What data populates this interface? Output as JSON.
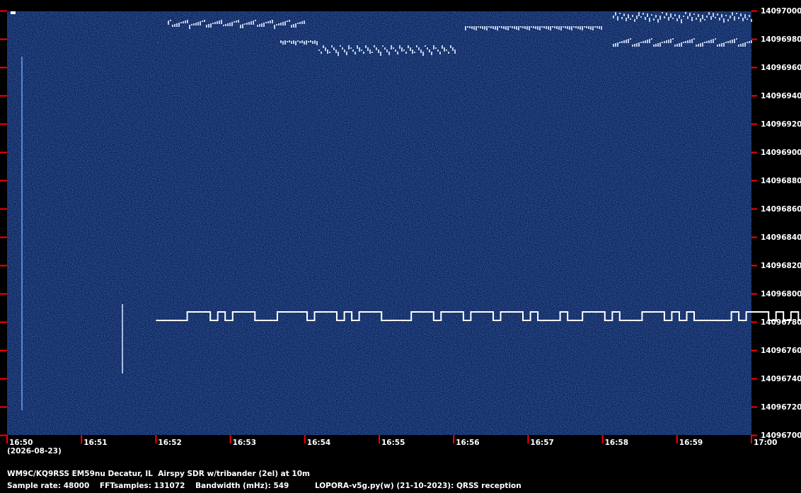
{
  "footer": {
    "station": "WM9C/KQ9RSS EM59nu Decatur, IL  Airspy SDR w/tribander (2el) at 10m",
    "sample_rate_label": "Sample rate: 48000",
    "fft_label": "FFTsamples: 131072",
    "bandwidth_label": "Bandwidth (mHz): 549",
    "software_label": "LOPORA-v5g.py(w) (21-10-2023): QRSS reception"
  },
  "date": "(2026-08-23)",
  "colors": {
    "background": "#0b2158",
    "tick": "#ff0000",
    "trace": "#ffffff",
    "frame": "#000000"
  },
  "chart_data": {
    "type": "heatmap",
    "title": "",
    "xlabel": "",
    "ylabel": "",
    "x_ticks": [
      "16:50",
      "16:51",
      "16:52",
      "16:53",
      "16:54",
      "16:55",
      "16:56",
      "16:57",
      "16:58",
      "16:59",
      "17:00"
    ],
    "y_ticks": [
      14097000,
      14096980,
      14096960,
      14096940,
      14096920,
      14096900,
      14096880,
      14096860,
      14096840,
      14096820,
      14096800,
      14096780,
      14096760,
      14096740,
      14096720,
      14096700
    ],
    "xlim": [
      "16:50",
      "17:00"
    ],
    "ylim": [
      14096700,
      14097000
    ],
    "grid": false,
    "fsk_trace": {
      "name": "",
      "start": "16:52",
      "end": "16:59.8",
      "low_freq": 14096781,
      "high_freq": 14096785,
      "segments_minutes_low_high": [
        [
          0.0,
          0.42,
          0
        ],
        [
          0.42,
          0.73,
          1
        ],
        [
          0.73,
          0.83,
          0
        ],
        [
          0.83,
          0.93,
          1
        ],
        [
          0.93,
          1.03,
          0
        ],
        [
          1.03,
          1.33,
          1
        ],
        [
          1.33,
          1.63,
          0
        ],
        [
          1.63,
          2.03,
          1
        ],
        [
          2.03,
          2.13,
          0
        ],
        [
          2.13,
          2.43,
          1
        ],
        [
          2.43,
          2.53,
          0
        ],
        [
          2.53,
          2.63,
          1
        ],
        [
          2.63,
          2.73,
          0
        ],
        [
          2.73,
          3.03,
          1
        ],
        [
          3.03,
          3.43,
          0
        ],
        [
          3.43,
          3.73,
          1
        ],
        [
          3.73,
          3.83,
          0
        ],
        [
          3.83,
          4.13,
          1
        ],
        [
          4.13,
          4.23,
          0
        ],
        [
          4.23,
          4.53,
          1
        ],
        [
          4.53,
          4.63,
          0
        ],
        [
          4.63,
          4.93,
          1
        ],
        [
          4.93,
          5.03,
          0
        ],
        [
          5.03,
          5.13,
          1
        ],
        [
          5.13,
          5.43,
          0
        ],
        [
          5.43,
          5.53,
          1
        ],
        [
          5.53,
          5.73,
          0
        ],
        [
          5.73,
          6.03,
          1
        ],
        [
          6.03,
          6.13,
          0
        ],
        [
          6.13,
          6.23,
          1
        ],
        [
          6.23,
          6.53,
          0
        ],
        [
          6.53,
          6.83,
          1
        ],
        [
          6.83,
          6.93,
          0
        ],
        [
          6.93,
          7.03,
          1
        ],
        [
          7.03,
          7.13,
          0
        ],
        [
          7.13,
          7.23,
          1
        ],
        [
          7.23,
          7.73,
          0
        ],
        [
          7.73,
          7.83,
          1
        ],
        [
          7.83,
          7.93,
          0
        ],
        [
          7.93,
          8.23,
          1
        ],
        [
          8.23,
          8.33,
          0
        ],
        [
          8.33,
          8.43,
          1
        ],
        [
          8.43,
          8.53,
          0
        ],
        [
          8.53,
          8.63,
          1
        ],
        [
          8.63,
          8.73,
          0
        ],
        [
          8.73,
          9.13,
          1
        ],
        [
          9.13,
          9.23,
          0
        ],
        [
          9.23,
          9.33,
          1
        ],
        [
          9.33,
          9.43,
          0
        ],
        [
          9.43,
          9.53,
          1
        ],
        [
          9.53,
          9.83,
          0
        ]
      ]
    }
  }
}
